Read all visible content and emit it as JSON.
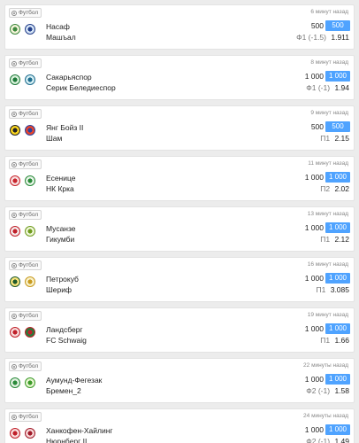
{
  "sport_icon": "soccer-ball-icon",
  "accent": "#4fa3ff",
  "bets": [
    {
      "sport": "Футбол",
      "time": "6 минут назад",
      "home": "Насаф",
      "away": "Машъал",
      "amount": "500",
      "amount_button": "500",
      "market": "Ф1 (-1.5)",
      "odds": "1.911",
      "home_logo": [
        "#f3f3d8",
        "#3f8a3f"
      ],
      "away_logo": [
        "#d5e4f6",
        "#233f8a"
      ]
    },
    {
      "sport": "Футбол",
      "time": "8 минут назад",
      "home": "Сакарьяспор",
      "away": "Серик Беледиеспор",
      "amount": "1 000",
      "amount_button": "1 000",
      "market": "Ф1 (-1)",
      "odds": "1.94",
      "home_logo": [
        "#d6efd8",
        "#1f7a3a"
      ],
      "away_logo": [
        "#d4eef3",
        "#1f6d8f"
      ]
    },
    {
      "sport": "Футбол",
      "time": "9 минут назад",
      "home": "Янг Бойз II",
      "away": "Шам",
      "amount": "500",
      "amount_button": "500",
      "market": "П1",
      "odds": "2.15",
      "home_logo": [
        "#f7d21d",
        "#222222"
      ],
      "away_logo": [
        "#e8442b",
        "#2a43a0"
      ]
    },
    {
      "sport": "Футбол",
      "time": "11 минут назад",
      "home": "Есенице",
      "away": "НК Крка",
      "amount": "1 000",
      "amount_button": "1 000",
      "market": "П2",
      "odds": "2.02",
      "home_logo": [
        "#f7dede",
        "#c8262e"
      ],
      "away_logo": [
        "#e7f4e7",
        "#2a8a3a"
      ]
    },
    {
      "sport": "Футбол",
      "time": "13 минут назад",
      "home": "Мусанзе",
      "away": "Гикумби",
      "amount": "1 000",
      "amount_button": "1 000",
      "market": "П1",
      "odds": "2.12",
      "home_logo": [
        "#f4e8e8",
        "#c0202a"
      ],
      "away_logo": [
        "#eef6d6",
        "#6f9b1f"
      ]
    },
    {
      "sport": "Футбол",
      "time": "16 минут назад",
      "home": "Петрокуб",
      "away": "Шериф",
      "amount": "1 000",
      "amount_button": "1 000",
      "market": "П1",
      "odds": "3.085",
      "home_logo": [
        "#f6e27a",
        "#1f5a2a"
      ],
      "away_logo": [
        "#f8f0c8",
        "#c89a1f"
      ]
    },
    {
      "sport": "Футбол",
      "time": "19 минут назад",
      "home": "Ландсберг",
      "away": "FC Schwaig",
      "amount": "1 000",
      "amount_button": "1 000",
      "market": "П1",
      "odds": "1.66",
      "home_logo": [
        "#f6d8d8",
        "#c0202a"
      ],
      "away_logo": [
        "#2a7a3a",
        "#c0202a"
      ]
    },
    {
      "sport": "Футбол",
      "time": "22 минуты назад",
      "home": "Аумунд-Фегезак",
      "away": "Бремен_2",
      "amount": "1 000",
      "amount_button": "1 000",
      "market": "Ф2 (-1)",
      "odds": "1.58",
      "home_logo": [
        "#dff0df",
        "#2a8a3a"
      ],
      "away_logo": [
        "#e6f6d0",
        "#3c9a2a"
      ]
    },
    {
      "sport": "Футбол",
      "time": "24 минуты назад",
      "home": "Ханкофен-Хайлинг",
      "away": "Нюрнберг II",
      "amount": "1 000",
      "amount_button": "1 000",
      "market": "Ф2 (-1)",
      "odds": "1.49",
      "home_logo": [
        "#f8dada",
        "#c0202a"
      ],
      "away_logo": [
        "#f6d6d6",
        "#a01a2a"
      ]
    }
  ]
}
